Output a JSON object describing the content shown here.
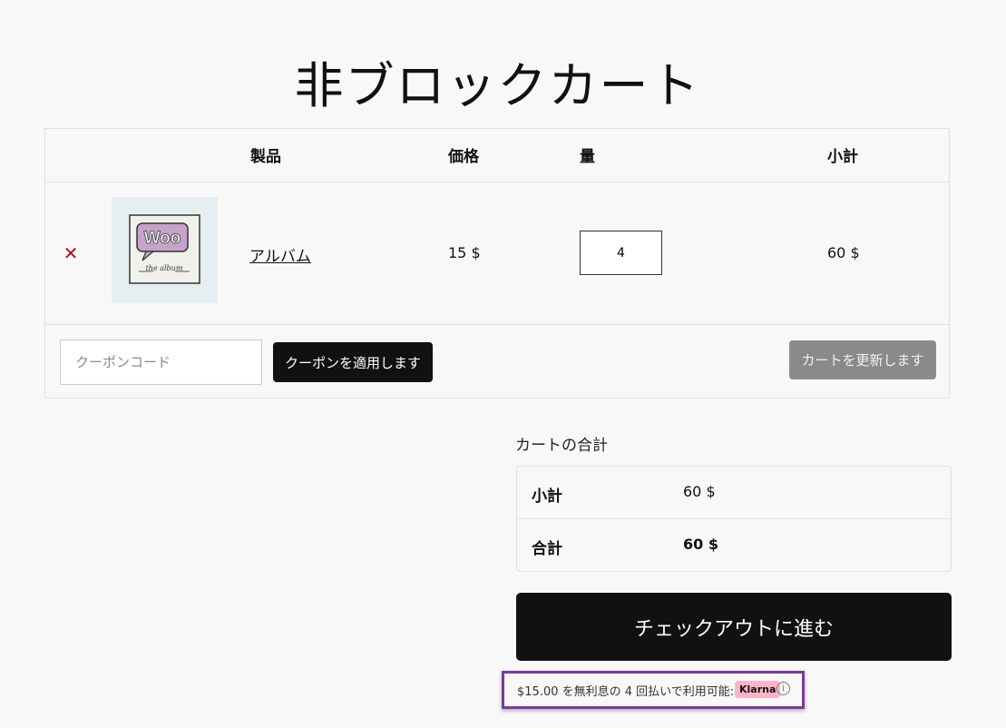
{
  "page": {
    "title": "非ブロックカート"
  },
  "cart_table": {
    "headers": {
      "product": "製品",
      "price": "価格",
      "quantity": "量",
      "subtotal": "小計"
    },
    "items": [
      {
        "remove_icon": "close-icon",
        "thumbnail_logo": "Woo",
        "thumbnail_caption": "the album",
        "name": "アルバム",
        "price": "15 $",
        "quantity": "4",
        "subtotal": "60 $"
      }
    ],
    "coupon": {
      "placeholder": "クーポンコード",
      "apply_label": "クーポンを適用します"
    },
    "update_label": "カートを更新します"
  },
  "totals": {
    "heading": "カートの合計",
    "rows": [
      {
        "label": "小計",
        "value": "60 $"
      },
      {
        "label": "合計",
        "value": "60 $"
      }
    ]
  },
  "checkout": {
    "label": "チェックアウトに進む"
  },
  "klarna": {
    "message": "$15.00 を無利息の 4 回払いで利用可能:",
    "badge": "Klarna",
    "info_icon": "info-icon",
    "info_glyph": "i"
  },
  "colors": {
    "background": "#f8f8f8",
    "primary_button": "#111111",
    "disabled_button": "#8a8a8a",
    "remove_icon": "#b0102a",
    "klarna_pink": "#ffb3c7",
    "highlight_border": "#7a3b9c"
  }
}
